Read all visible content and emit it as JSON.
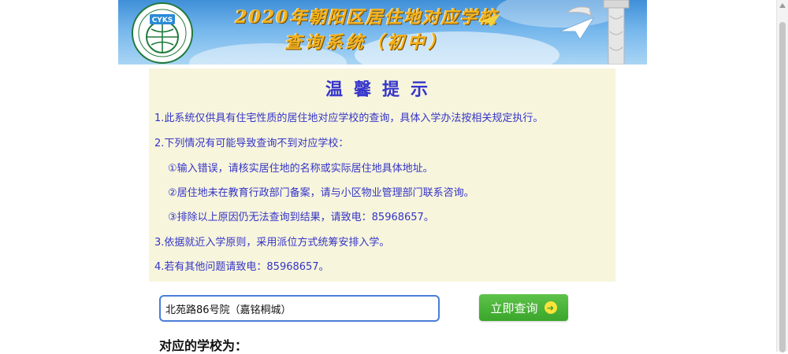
{
  "banner": {
    "logo_text": "CYKS",
    "title": "2020年朝阳区居住地对应学校",
    "subtitle": "查询系统（初中）"
  },
  "notice": {
    "title": "温馨提示",
    "lines": [
      "1.此系统仅供具有住宅性质的居住地对应学校的查询，具体入学办法按相关规定执行。",
      "2.下列情况有可能导致查询不到对应学校：",
      "①输入错误，请核实居住地的名称或实际居住地具体地址。",
      "②居住地未在教育行政部门备案，请与小区物业管理部门联系咨询。",
      "③排除以上原因仍无法查询到结果，请致电：85968657。",
      "3.依据就近入学原则，采用派位方式统筹安排入学。",
      "4.若有其他问题请致电：85968657。"
    ]
  },
  "search": {
    "value": "北苑路86号院（嘉铭桐城）",
    "button_label": "立即查询",
    "button_icon": "arrow-right-circle-icon"
  },
  "result": {
    "label": "对应的学校为："
  },
  "colors": {
    "notice_bg": "#f7f5dc",
    "notice_text": "#3434c8",
    "button_green": "#3aa62b",
    "banner_title": "#f2b21e"
  }
}
